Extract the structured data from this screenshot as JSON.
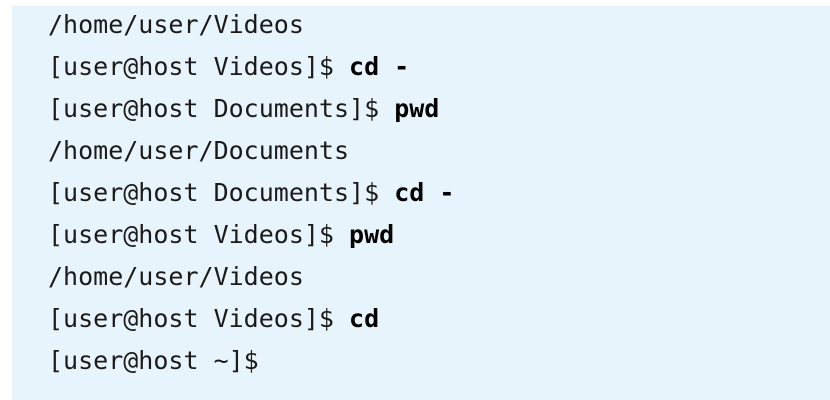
{
  "terminal": {
    "lines": [
      {
        "prompt": "/home/user/Videos",
        "command": ""
      },
      {
        "prompt": "[user@host Videos]$ ",
        "command": "cd -"
      },
      {
        "prompt": "[user@host Documents]$ ",
        "command": "pwd"
      },
      {
        "prompt": "/home/user/Documents",
        "command": ""
      },
      {
        "prompt": "[user@host Documents]$ ",
        "command": "cd -"
      },
      {
        "prompt": "[user@host Videos]$ ",
        "command": "pwd"
      },
      {
        "prompt": "/home/user/Videos",
        "command": ""
      },
      {
        "prompt": "[user@host Videos]$ ",
        "command": "cd"
      },
      {
        "prompt": "[user@host ~]$",
        "command": ""
      }
    ]
  },
  "colors": {
    "background": "#e8f4fb",
    "text": "#1a1a1a"
  }
}
